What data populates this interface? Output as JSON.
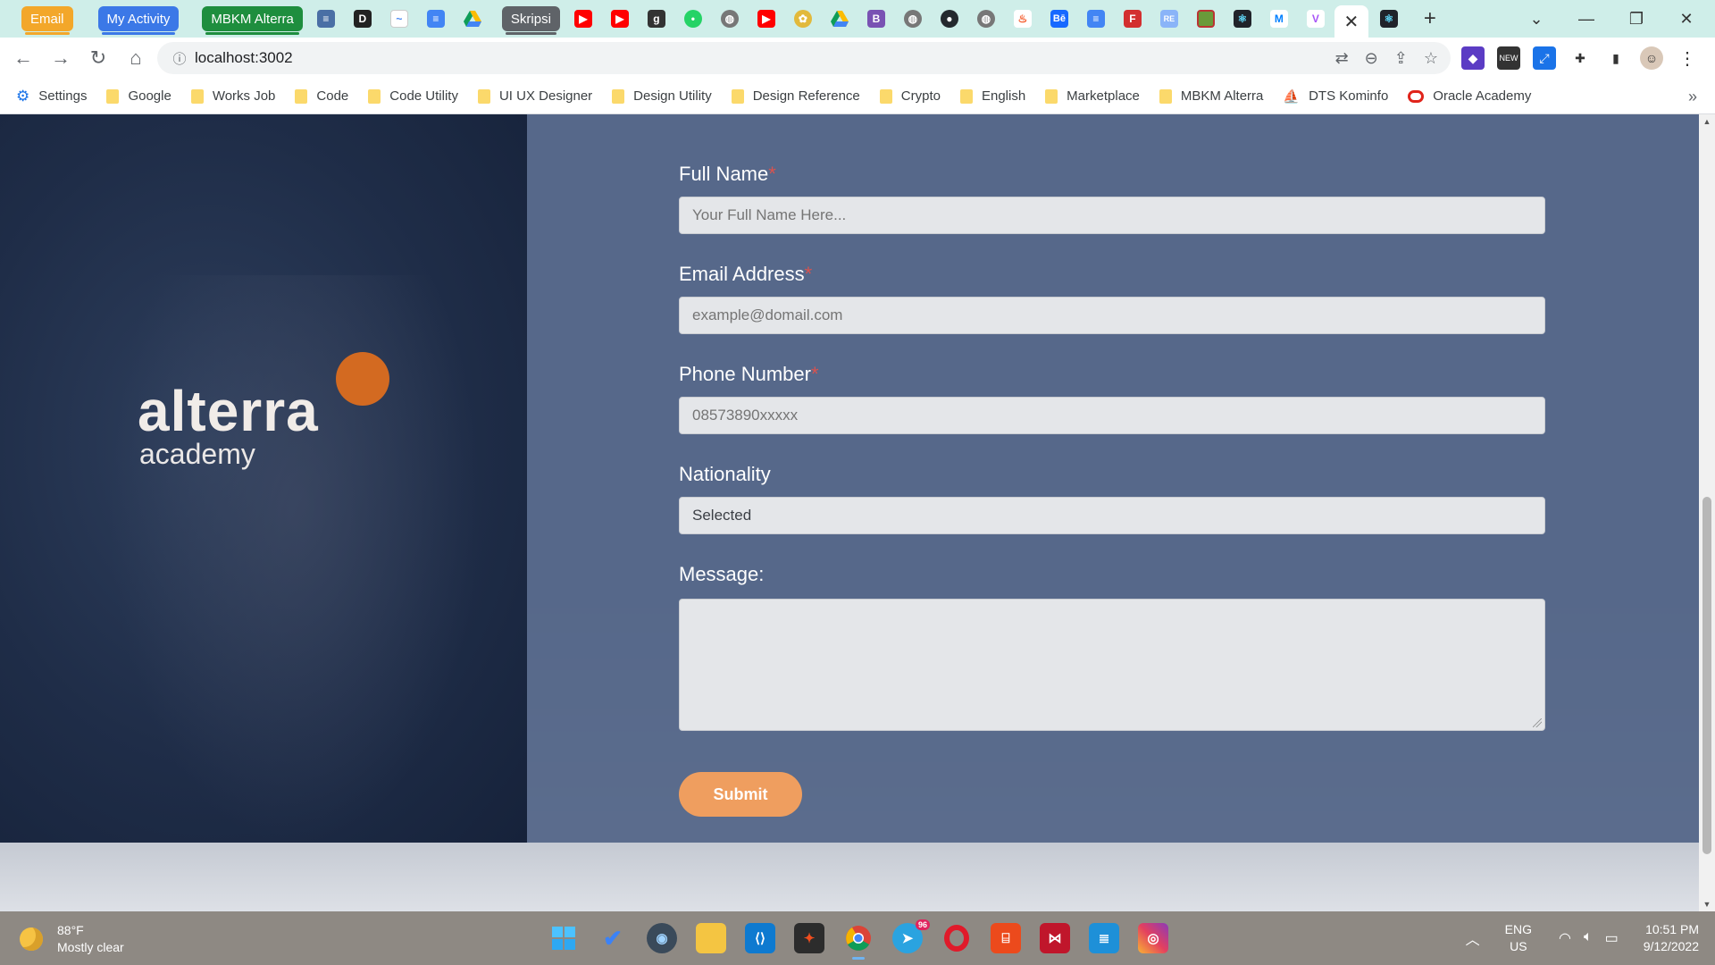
{
  "browser": {
    "tabs": [
      {
        "label": "Email",
        "bg": "#f3a72a",
        "fg": "#ffffff",
        "underline": "#f3a72a"
      },
      {
        "label": "My Activity",
        "bg": "#3b78e7",
        "fg": "#ffffff",
        "underline": "#3b78e7"
      },
      {
        "label": "MBKM Alterra",
        "bg": "#1e8e3e",
        "fg": "#ffffff",
        "underline": "#1e8e3e"
      }
    ],
    "tab_group_skripsi": "Skripsi",
    "url": "localhost:3002",
    "active_tab_close": "✕",
    "new_tab": "+"
  },
  "bookmarks": [
    {
      "label": "Settings",
      "icon": "gear-icon"
    },
    {
      "label": "Google",
      "icon": "folder-icon"
    },
    {
      "label": "Works Job",
      "icon": "folder-icon"
    },
    {
      "label": "Code",
      "icon": "folder-icon"
    },
    {
      "label": "Code Utility",
      "icon": "folder-icon"
    },
    {
      "label": "UI UX Designer",
      "icon": "folder-icon"
    },
    {
      "label": "Design Utility",
      "icon": "folder-icon"
    },
    {
      "label": "Design Reference",
      "icon": "folder-icon"
    },
    {
      "label": "Crypto",
      "icon": "folder-icon"
    },
    {
      "label": "English",
      "icon": "folder-icon"
    },
    {
      "label": "Marketplace",
      "icon": "folder-icon"
    },
    {
      "label": "MBKM Alterra",
      "icon": "folder-icon"
    },
    {
      "label": "DTS Kominfo",
      "icon": "dts-icon"
    },
    {
      "label": "Oracle Academy",
      "icon": "oracle-icon"
    }
  ],
  "brand": {
    "word": "alterra",
    "sub": "academy",
    "accent": "#d36a21"
  },
  "form": {
    "full_name": {
      "label": "Full Name",
      "required": "*",
      "placeholder": "Your Full Name Here..."
    },
    "email": {
      "label": "Email Address",
      "required": "*",
      "placeholder": "example@domail.com"
    },
    "phone": {
      "label": "Phone Number",
      "required": "*",
      "placeholder": "08573890xxxxx"
    },
    "nationality": {
      "label": "Nationality",
      "selected": "Selected"
    },
    "message": {
      "label": "Message:"
    },
    "submit": "Submit"
  },
  "taskbar": {
    "temperature": "88°F",
    "condition": "Mostly clear",
    "lang_top": "ENG",
    "lang_bottom": "US",
    "time": "10:51 PM",
    "date": "9/12/2022",
    "telegram_badge": "96"
  }
}
